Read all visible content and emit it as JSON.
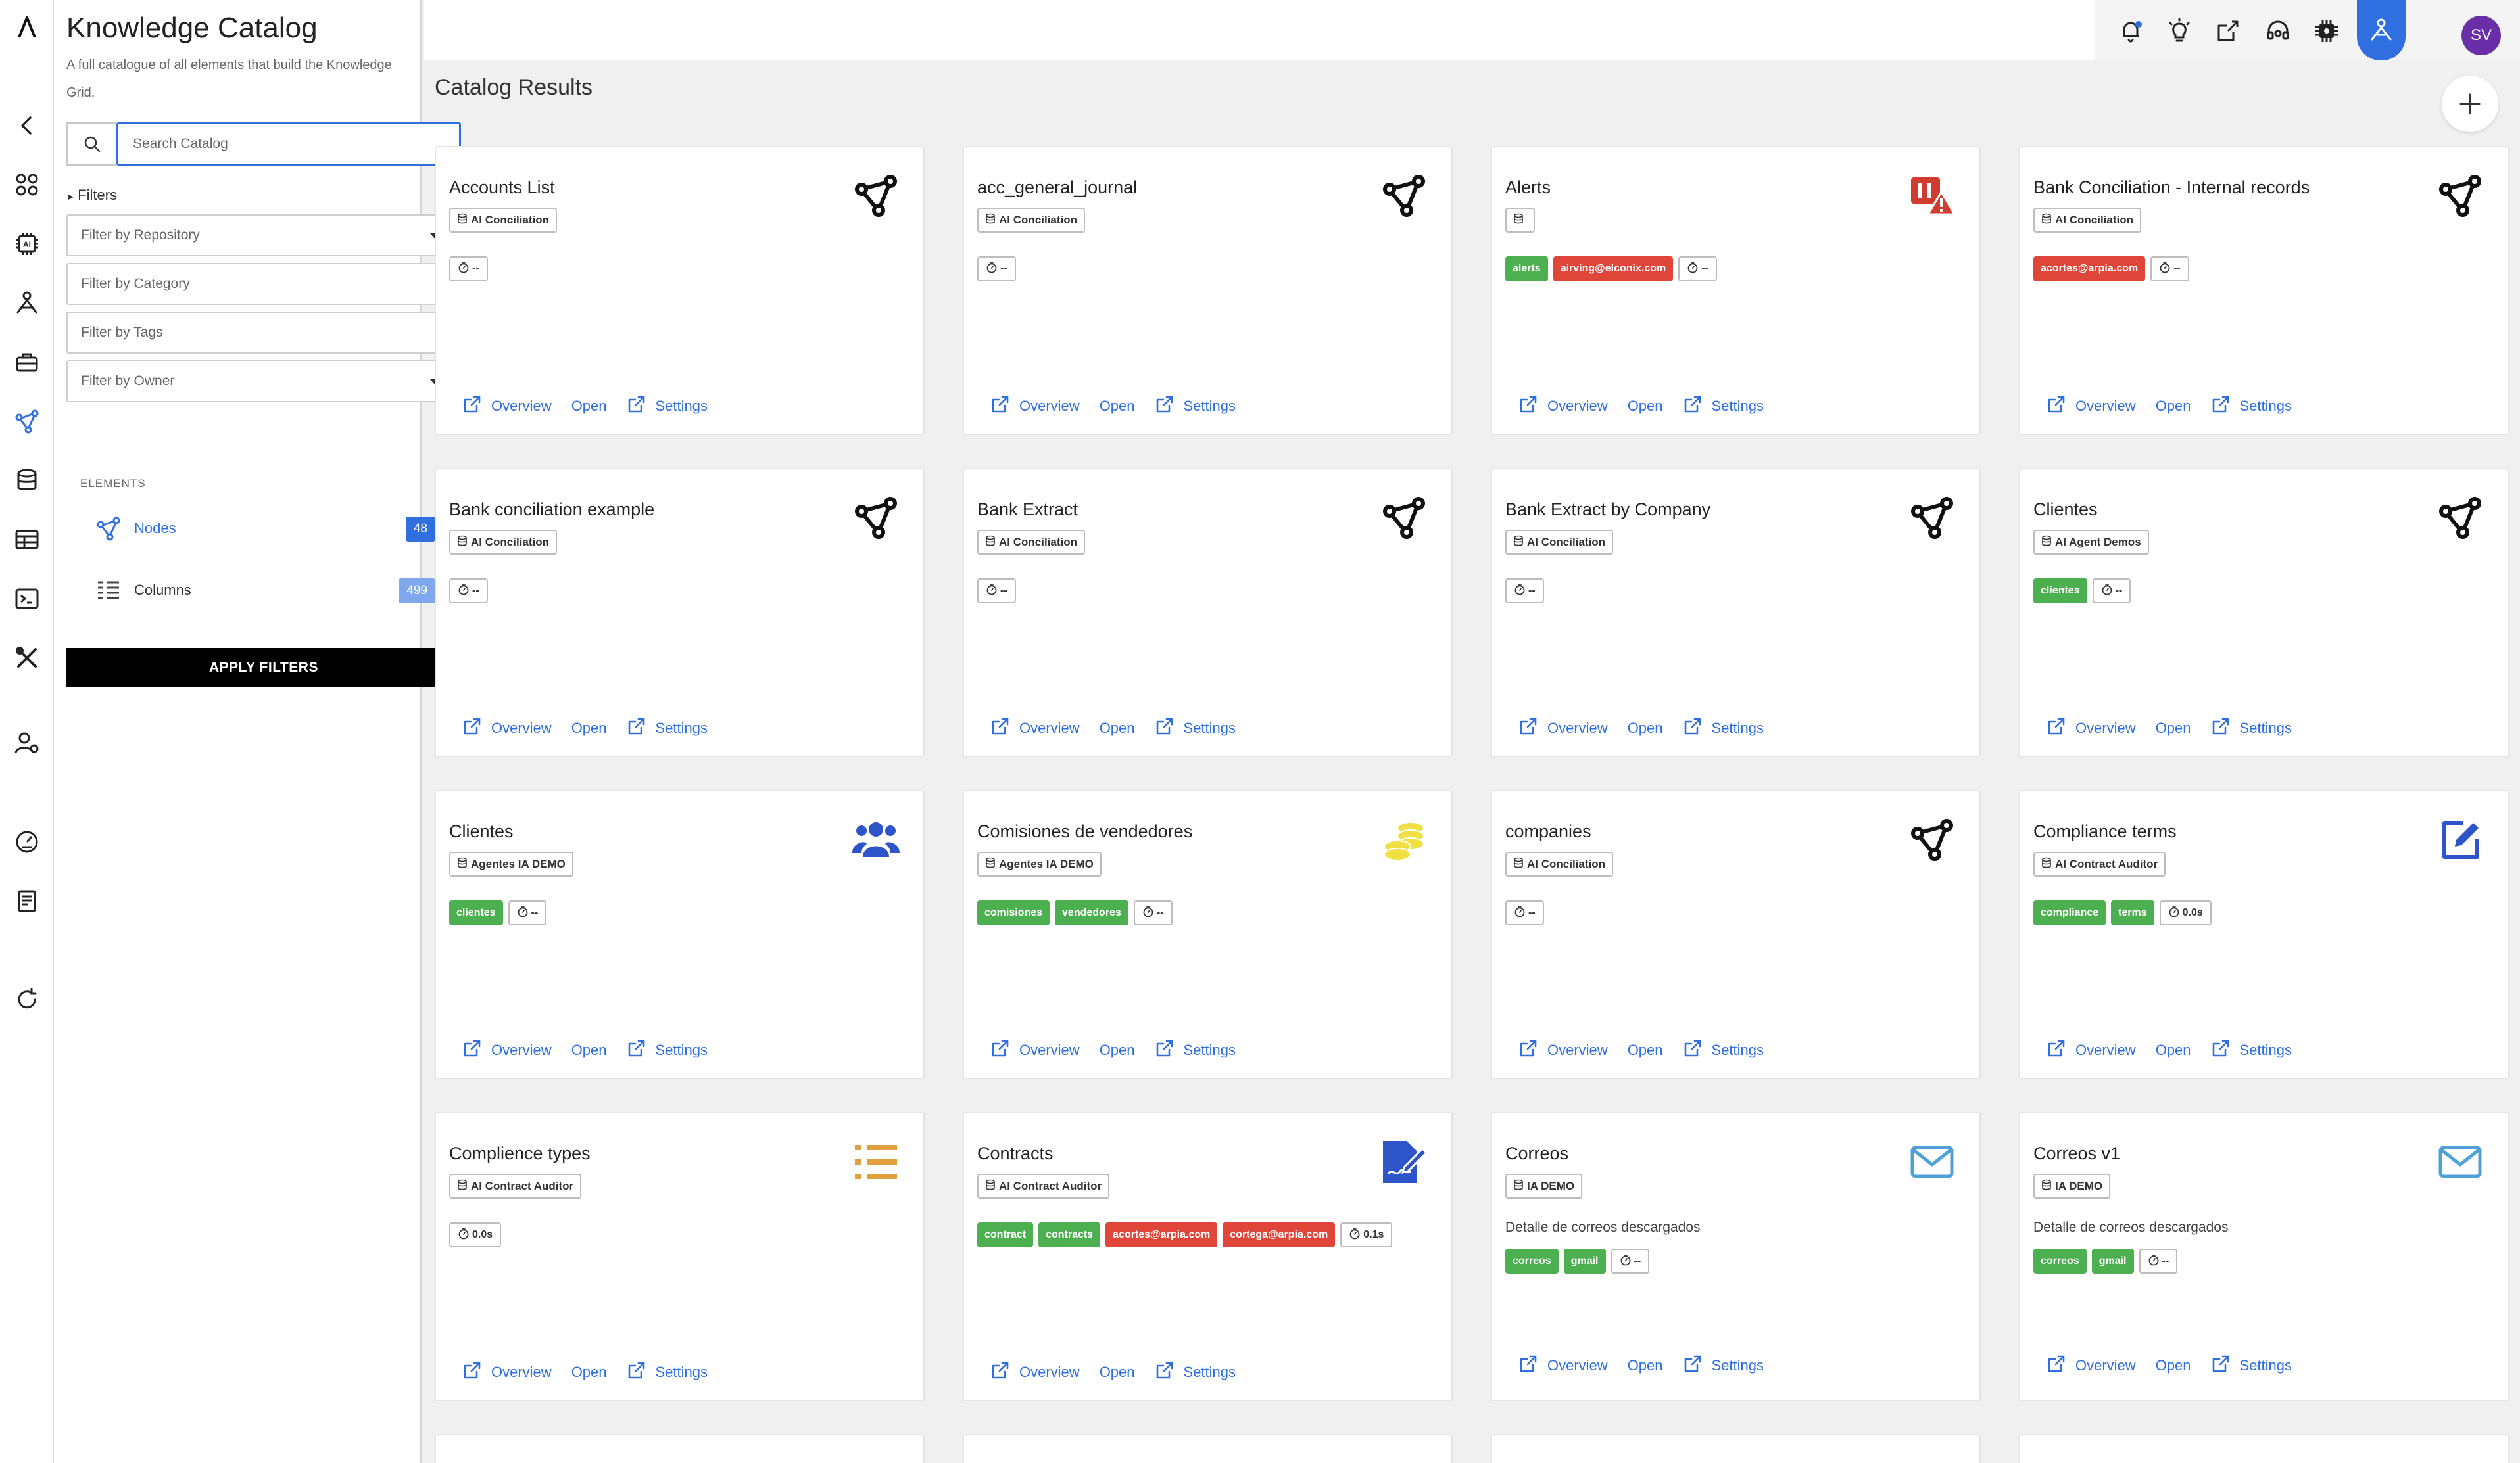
{
  "app": {
    "logo": "logo-icon"
  },
  "rail": {
    "icons": [
      "back-arrow-icon",
      "apps-grid-icon",
      "ai-chip-icon",
      "agent-icon",
      "toolbox-icon",
      "graph-nodes-icon",
      "database-icon",
      "table-icon",
      "terminal-icon",
      "tools-icon",
      "user-settings-icon",
      "dashboard-gauge-icon",
      "notebook-icon",
      "refresh-icon"
    ]
  },
  "panel": {
    "title": "Knowledge Catalog",
    "subtitle": "A full catalogue of all elements that build the Knowledge Grid.",
    "search_placeholder": "Search Catalog",
    "filters_label": "Filters",
    "filter_repository": "Filter by Repository",
    "filter_category": "Filter by Category",
    "filter_tags": "Filter by Tags",
    "filter_owner": "Filter by Owner",
    "elements_heading": "ELEMENTS",
    "elements": [
      {
        "label": "Nodes",
        "count": "48",
        "color": "#2f6fe0"
      },
      {
        "label": "Columns",
        "count": "499",
        "color": "#7fa8ee"
      }
    ],
    "apply_label": "APPLY FILTERS"
  },
  "topbar": {
    "icons": [
      "notifications-icon",
      "lightbulb-icon",
      "share-icon",
      "support-headset-icon",
      "chip-settings-icon",
      "apps-icon",
      "agent-active-icon"
    ],
    "avatar": "SV"
  },
  "main": {
    "title": "Catalog Results",
    "actions": {
      "overview": "Overview",
      "open": "Open",
      "settings": "Settings"
    },
    "cards": [
      {
        "title": "Accounts List",
        "repo": "AI Conciliation",
        "icon": "graph-icon",
        "chips": [
          {
            "t": "--",
            "k": "timer"
          }
        ]
      },
      {
        "title": "acc_general_journal",
        "repo": "AI Conciliation",
        "icon": "graph-icon",
        "chips": [
          {
            "t": "--",
            "k": "timer"
          }
        ]
      },
      {
        "title": "Alerts",
        "repo": "",
        "icon": "alert-icon",
        "chips": [
          {
            "t": "alerts",
            "k": "green"
          },
          {
            "t": "airving@elconix.com",
            "k": "red"
          },
          {
            "t": "--",
            "k": "timer"
          }
        ]
      },
      {
        "title": "Bank Conciliation - Internal records",
        "repo": "AI Conciliation",
        "icon": "graph-icon",
        "chips": [
          {
            "t": "acortes@arpia.com",
            "k": "red"
          },
          {
            "t": "--",
            "k": "timer"
          }
        ]
      },
      {
        "title": "Bank conciliation example",
        "repo": "AI Conciliation",
        "icon": "graph-icon",
        "chips": [
          {
            "t": "--",
            "k": "timer"
          }
        ]
      },
      {
        "title": "Bank Extract",
        "repo": "AI Conciliation",
        "icon": "graph-icon",
        "chips": [
          {
            "t": "--",
            "k": "timer"
          }
        ]
      },
      {
        "title": "Bank Extract by Company",
        "repo": "AI Conciliation",
        "icon": "graph-icon",
        "chips": [
          {
            "t": "--",
            "k": "timer"
          }
        ]
      },
      {
        "title": "Clientes",
        "repo": "AI Agent Demos",
        "icon": "graph-icon",
        "chips": [
          {
            "t": "clientes",
            "k": "green"
          },
          {
            "t": "--",
            "k": "timer"
          }
        ]
      },
      {
        "title": "Clientes",
        "repo": "Agentes IA DEMO",
        "icon": "users-icon",
        "chips": [
          {
            "t": "clientes",
            "k": "green"
          },
          {
            "t": "--",
            "k": "timer"
          }
        ]
      },
      {
        "title": "Comisiones de vendedores",
        "repo": "Agentes IA DEMO",
        "icon": "coins-icon",
        "chips": [
          {
            "t": "comisiones",
            "k": "green"
          },
          {
            "t": "vendedores",
            "k": "green"
          },
          {
            "t": "--",
            "k": "timer"
          }
        ]
      },
      {
        "title": "companies",
        "repo": "AI Conciliation",
        "icon": "graph-icon",
        "chips": [
          {
            "t": "--",
            "k": "timer"
          }
        ]
      },
      {
        "title": "Compliance terms",
        "repo": "AI Contract Auditor",
        "icon": "edit-icon",
        "chips": [
          {
            "t": "compliance",
            "k": "green"
          },
          {
            "t": "terms",
            "k": "green"
          },
          {
            "t": "0.0s",
            "k": "timer"
          }
        ]
      },
      {
        "title": "Complience types",
        "repo": "AI Contract Auditor",
        "icon": "list-icon",
        "chips": [
          {
            "t": "0.0s",
            "k": "timer"
          }
        ]
      },
      {
        "title": "Contracts",
        "repo": "AI Contract Auditor",
        "icon": "signature-icon",
        "chips": [
          {
            "t": "contract",
            "k": "green"
          },
          {
            "t": "contracts",
            "k": "green"
          },
          {
            "t": "acortes@arpia.com",
            "k": "red"
          },
          {
            "t": "cortega@arpia.com",
            "k": "red"
          },
          {
            "t": "0.1s",
            "k": "timer"
          }
        ]
      },
      {
        "title": "Correos",
        "repo": "IA DEMO",
        "icon": "mail-icon",
        "desc": "Detalle de correos descargados",
        "chips": [
          {
            "t": "correos",
            "k": "green"
          },
          {
            "t": "gmail",
            "k": "green"
          },
          {
            "t": "--",
            "k": "timer"
          }
        ]
      },
      {
        "title": "Correos v1",
        "repo": "IA DEMO",
        "icon": "mail-icon",
        "desc": "Detalle de correos descargados",
        "chips": [
          {
            "t": "correos",
            "k": "green"
          },
          {
            "t": "gmail",
            "k": "green"
          },
          {
            "t": "--",
            "k": "timer"
          }
        ]
      }
    ]
  }
}
